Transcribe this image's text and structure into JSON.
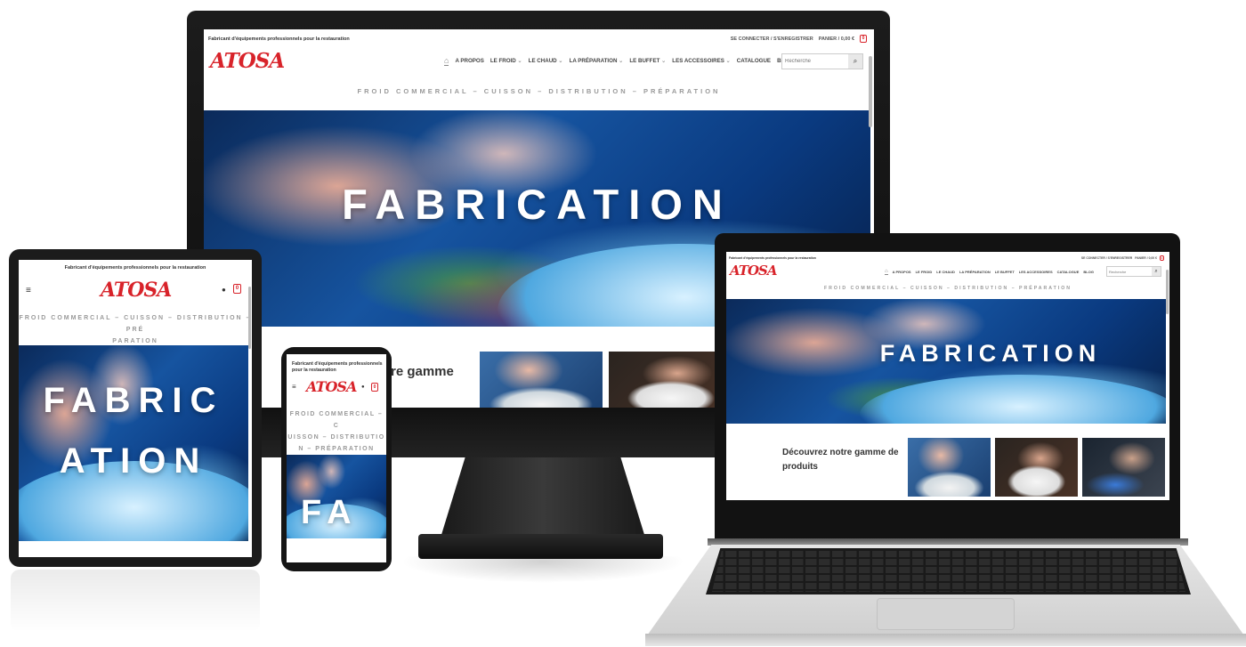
{
  "site": {
    "tagline_top": "Fabricant d'équipements professionnels pour la restauration",
    "login": "SE CONNECTER / S'ENREGISTRER",
    "cart_label": "PANIER / 0,00 €",
    "cart_count": "0",
    "logo": "ATOSA",
    "nav": [
      "A PROPOS",
      "LE FROID",
      "LE CHAUD",
      "LA PRÉPARATION",
      "LE BUFFET",
      "LES ACCESSOIRES",
      "CATALOGUE",
      "BLOG"
    ],
    "search_placeholder": "Recherche",
    "tagline": "FROID COMMERCIAL – CUISSON – DISTRIBUTION – PRÉPARATION",
    "hero_word": "FABRICATION",
    "products_heading": "Découvrez notre gamme de produits"
  },
  "monitor": {
    "products_fragment": "tre gamme"
  },
  "tablet": {
    "tagline_line1": "FROID COMMERCIAL – CUISSON – DISTRIBUTION – PRÉ",
    "tagline_line2": "PARATION",
    "hero_line1": "FABRIC",
    "hero_line2": "ATION"
  },
  "phone": {
    "tagline_top_line1": "Fabricant d'équipements professionnels",
    "tagline_top_line2": "pour la restauration",
    "tagline_line1": "FROID COMMERCIAL – C",
    "tagline_line2": "UISSON – DISTRIBUTIO",
    "tagline_line3": "N – PRÉPARATION",
    "hero_fragment": "FA"
  },
  "colors": {
    "brand": "#d8232a",
    "text": "#333333",
    "muted": "#999999"
  }
}
